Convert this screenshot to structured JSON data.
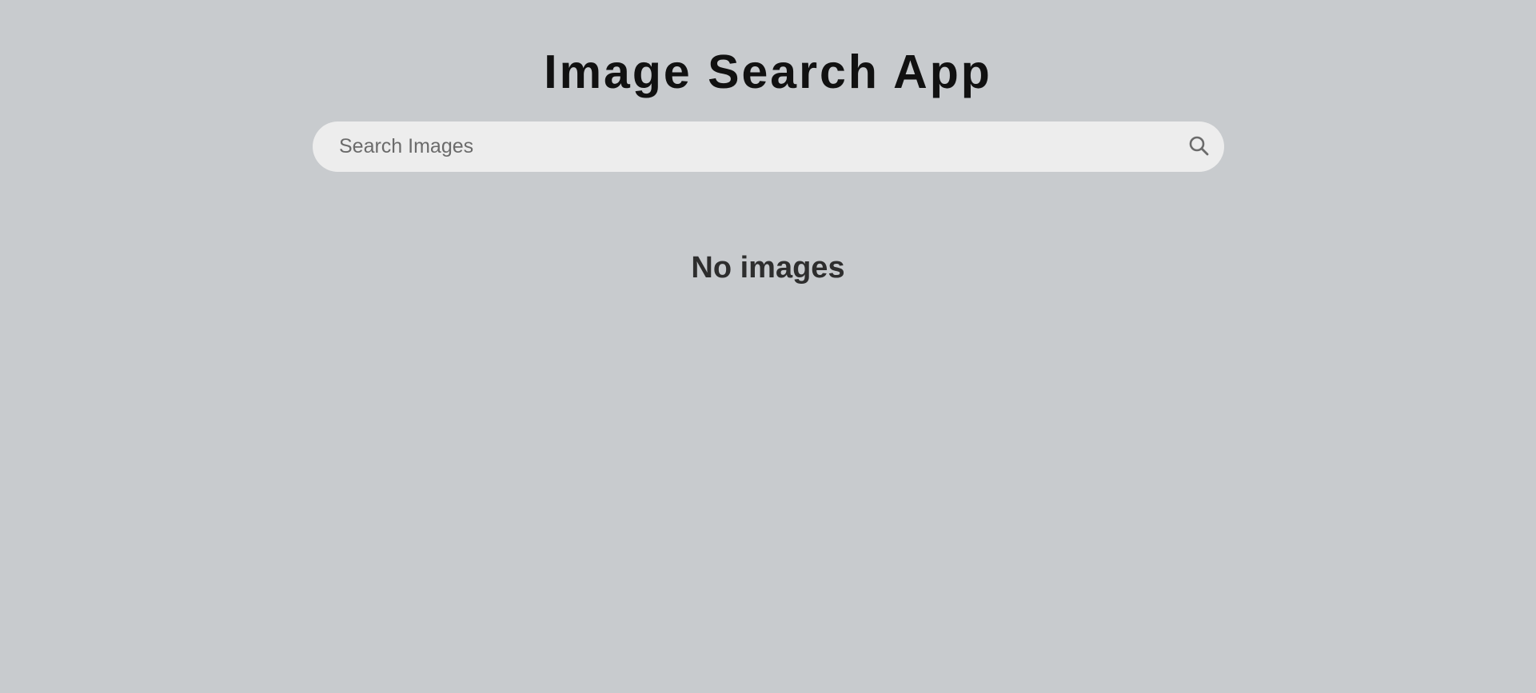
{
  "app": {
    "title": "Image Search App"
  },
  "search": {
    "placeholder": "Search Images",
    "value": "",
    "icon": "search-icon"
  },
  "results": {
    "empty_message": "No images"
  },
  "colors": {
    "background": "#c8cbce",
    "search_bar": "#ededed",
    "title_text": "#111111",
    "placeholder_text": "#6b6b6b",
    "message_text": "#2e2e2e"
  }
}
